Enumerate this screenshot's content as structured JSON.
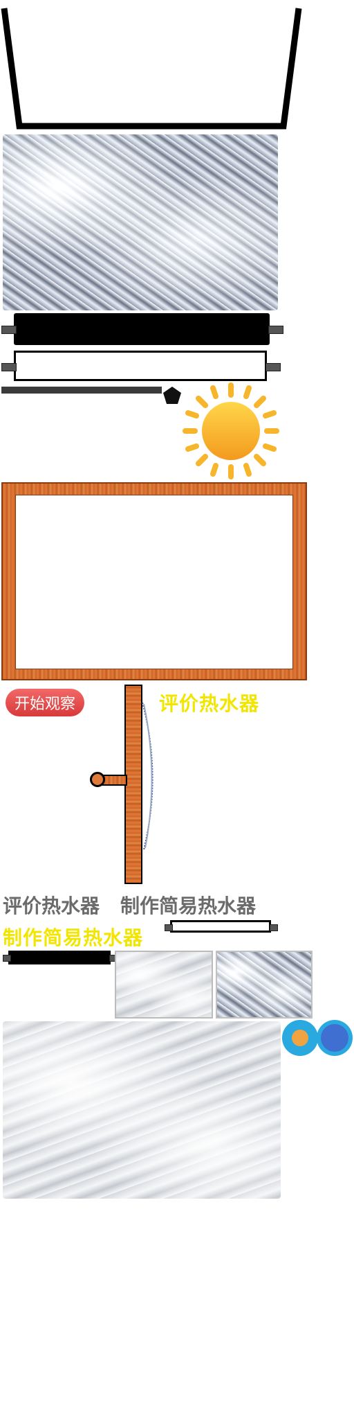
{
  "buttons": {
    "start_observe": "开始观察"
  },
  "labels": {
    "evaluate_heater": "评价热水器",
    "evaluate_heater_gray": "评价热水器",
    "make_heater_gray": "制作简易热水器",
    "make_heater_yellow": "制作简易热水器"
  },
  "colors": {
    "button_red": "#e84a4a",
    "label_yellow": "#f2e600",
    "label_gray": "#6b6b6b",
    "wood": "#d6682a",
    "sun": "#f6b52a",
    "dot_orange": "#f0a341",
    "dot_blue": "#3e6fd1",
    "dot_ring": "#2aa8e0"
  },
  "icons": {
    "sun": "sun-icon",
    "pentagon": "pentagon-icon"
  }
}
